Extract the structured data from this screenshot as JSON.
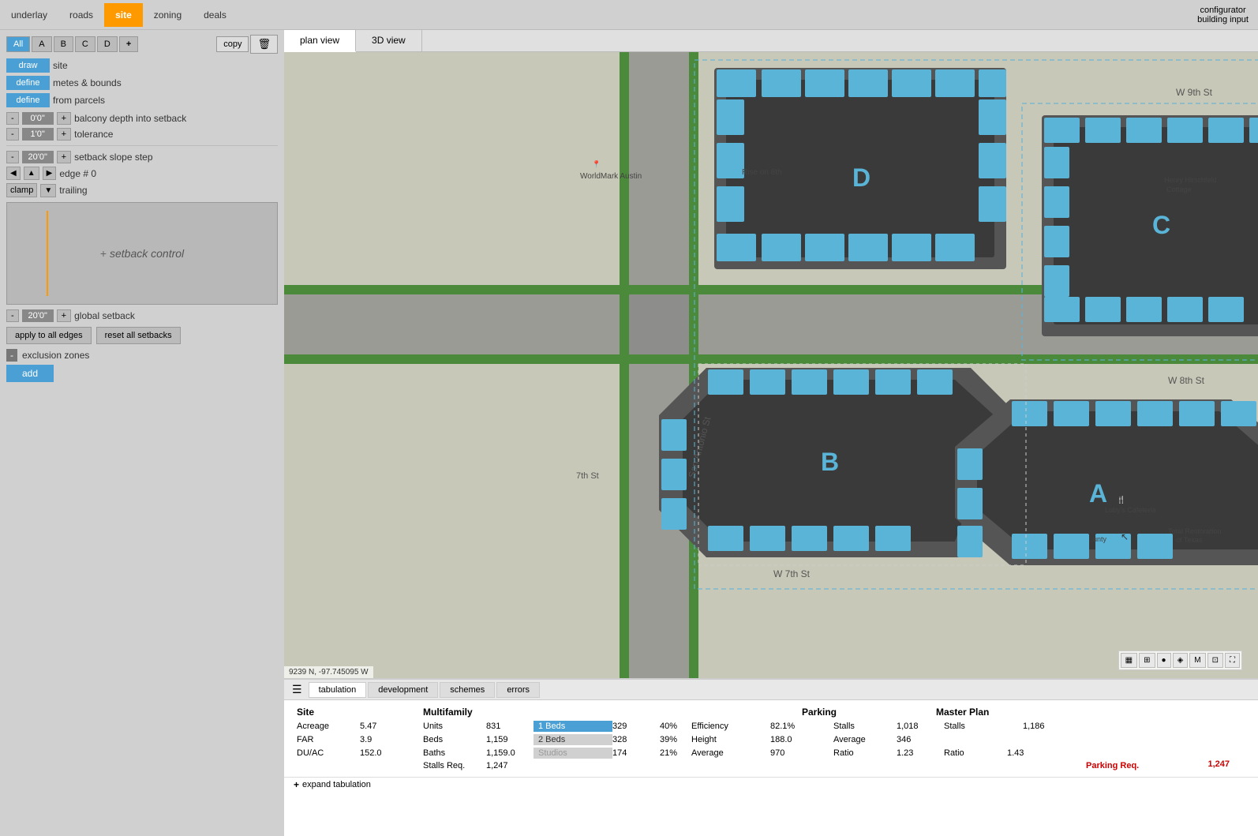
{
  "nav": {
    "items": [
      {
        "label": "underlay",
        "active": false
      },
      {
        "label": "roads",
        "active": false
      },
      {
        "label": "site",
        "active": true
      },
      {
        "label": "zoning",
        "active": false
      },
      {
        "label": "deals",
        "active": false
      }
    ],
    "configurator": "configurator",
    "building_input": "building input"
  },
  "left_panel": {
    "tabs": [
      "All",
      "A",
      "B",
      "C",
      "D"
    ],
    "copy_btn": "copy",
    "draw_btn": "draw",
    "draw_label": "site",
    "define_btn1": "define",
    "define_label1": "metes & bounds",
    "define_btn2": "define",
    "define_label2": "from parcels",
    "balcony_minus": "-",
    "balcony_value": "0'0\"",
    "balcony_plus": "+",
    "balcony_label": "balcony depth into setback",
    "tolerance_minus": "-",
    "tolerance_value": "1'0\"",
    "tolerance_plus": "+",
    "tolerance_label": "tolerance",
    "slope_minus": "-",
    "slope_value": "20'0\"",
    "slope_plus": "+",
    "slope_label": "setback slope step",
    "edge_label": "edge # 0",
    "clamp_label": "clamp",
    "trailing_label": "trailing",
    "setback_title": "setback control",
    "global_minus": "-",
    "global_value": "20'0\"",
    "global_plus": "+",
    "global_label": "global setback",
    "apply_all_btn": "apply to all edges",
    "reset_btn": "reset all setbacks",
    "exclusion_label": "exclusion zones",
    "add_btn": "add"
  },
  "view_tabs": {
    "plan": "plan view",
    "three_d": "3D view"
  },
  "map": {
    "label_a": "A",
    "label_b": "B",
    "label_c": "C",
    "label_d": "D",
    "coords": "9239 N, -97.745095 W"
  },
  "bottom_panel": {
    "tabs": [
      "tabulation",
      "development",
      "schemes",
      "errors"
    ],
    "active_tab": "tabulation",
    "sections": {
      "site": "Site",
      "multifamily": "Multifamily",
      "parking": "Parking",
      "master_plan": "Master Plan"
    },
    "rows": [
      {
        "label": "Acreage",
        "value": "5.47",
        "unit": ""
      },
      {
        "label": "FAR",
        "value": "3.9",
        "unit": ""
      },
      {
        "label": "DU/AC",
        "value": "152.0",
        "unit": ""
      }
    ],
    "multifamily": {
      "units_label": "Units",
      "units_value": "831",
      "beds_label": "Beds",
      "beds_value": "1,159",
      "baths_label": "Baths",
      "baths_value": "1,159.0",
      "stalls_label": "Stalls Req.",
      "stalls_value": "1,247"
    },
    "bed_types": [
      {
        "label": "1 Beds",
        "value": "329",
        "pct": "40%",
        "active": true
      },
      {
        "label": "2 Beds",
        "value": "328",
        "pct": "39%",
        "active": false
      },
      {
        "label": "Studios",
        "value": "174",
        "pct": "21%",
        "active": false
      }
    ],
    "efficiency": {
      "label": "Efficiency",
      "value": "82.1%"
    },
    "height": {
      "label": "Height",
      "value": "188.0"
    },
    "average": {
      "label": "Average",
      "value": "970"
    },
    "parking": {
      "stalls_label": "Stalls",
      "stalls_value": "1,018",
      "average_label": "Average",
      "average_value": "346",
      "ratio_label": "Ratio",
      "ratio_value": "1.23"
    },
    "master_plan": {
      "stalls_label": "Stalls",
      "stalls_value": "1,186",
      "ratio_label": "Ratio",
      "ratio_value": "1.43",
      "parking_req_label": "Parking Req.",
      "parking_req_value": "1,247"
    },
    "expand_label": "expand tabulation"
  }
}
